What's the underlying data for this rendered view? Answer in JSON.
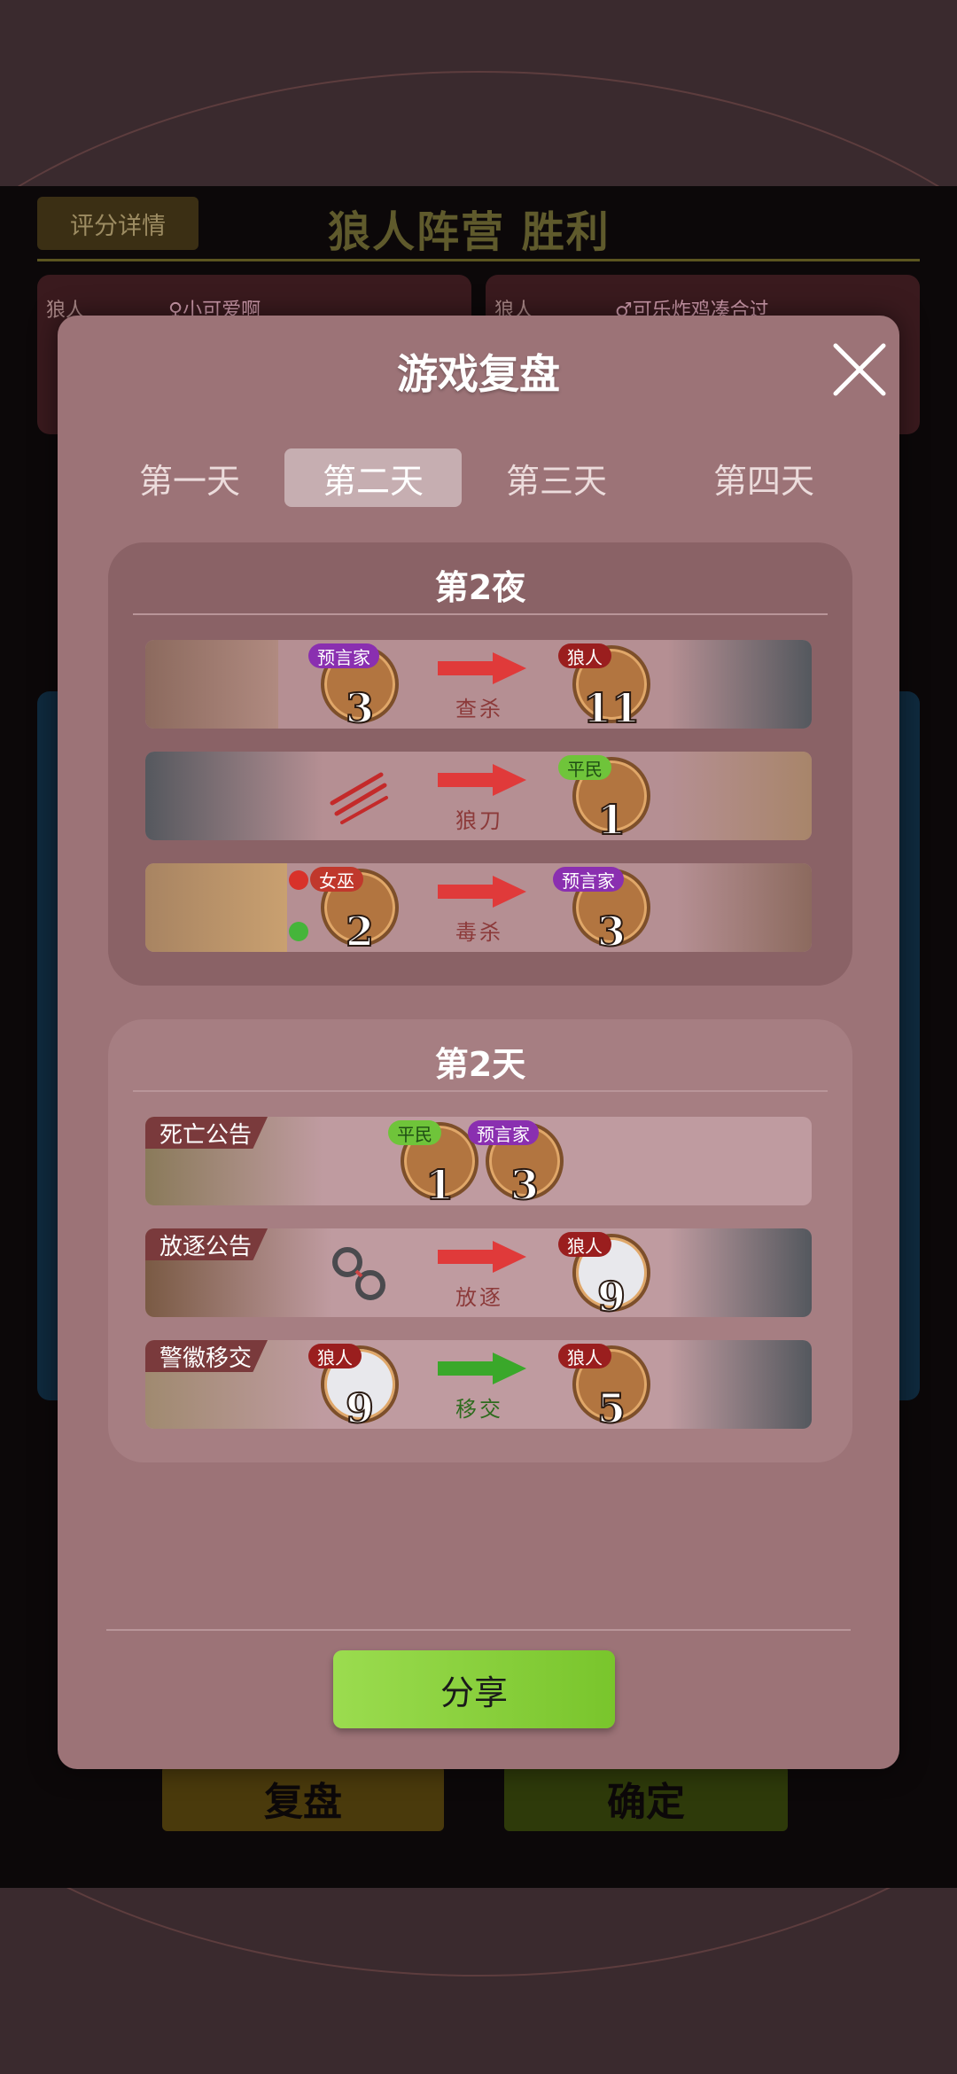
{
  "background": {
    "score_button": "评分详情",
    "result_title": "狼人阵营  胜利",
    "left_card_tag": "狼人",
    "left_card_name": "♀小可爱啊",
    "right_card_tag": "狼人",
    "right_card_name": "♂可乐炸鸡凑合过",
    "replay_button": "复盘",
    "confirm_button": "确定"
  },
  "modal": {
    "title": "游戏复盘",
    "tabs": [
      "第一天",
      "第二天",
      "第三天",
      "第四天"
    ],
    "active_tab": "第二天",
    "night": {
      "title": "第2夜",
      "rows": [
        {
          "from_badge": "预言家",
          "from_num": "3",
          "action": "查杀",
          "to_badge": "狼人",
          "to_num": "11"
        },
        {
          "action": "狼刀",
          "to_badge": "平民",
          "to_num": "1"
        },
        {
          "from_badge": "女巫",
          "from_num": "2",
          "action": "毒杀",
          "to_badge": "预言家",
          "to_num": "3"
        }
      ]
    },
    "day": {
      "title": "第2天",
      "rows": [
        {
          "label": "死亡公告",
          "a_badge": "平民",
          "a_num": "1",
          "b_badge": "预言家",
          "b_num": "3"
        },
        {
          "label": "放逐公告",
          "action": "放逐",
          "to_badge": "狼人",
          "to_num": "9"
        },
        {
          "label": "警徽移交",
          "from_badge": "狼人",
          "from_num": "9",
          "action": "移交",
          "to_badge": "狼人",
          "to_num": "5"
        }
      ]
    },
    "share_button": "分享"
  },
  "colors": {
    "night_section": "#8a6266",
    "day_section": "#a67e82",
    "share_green": "#8ad23c",
    "arrow_red": "#e03a3a",
    "arrow_green": "#3aa82a"
  }
}
